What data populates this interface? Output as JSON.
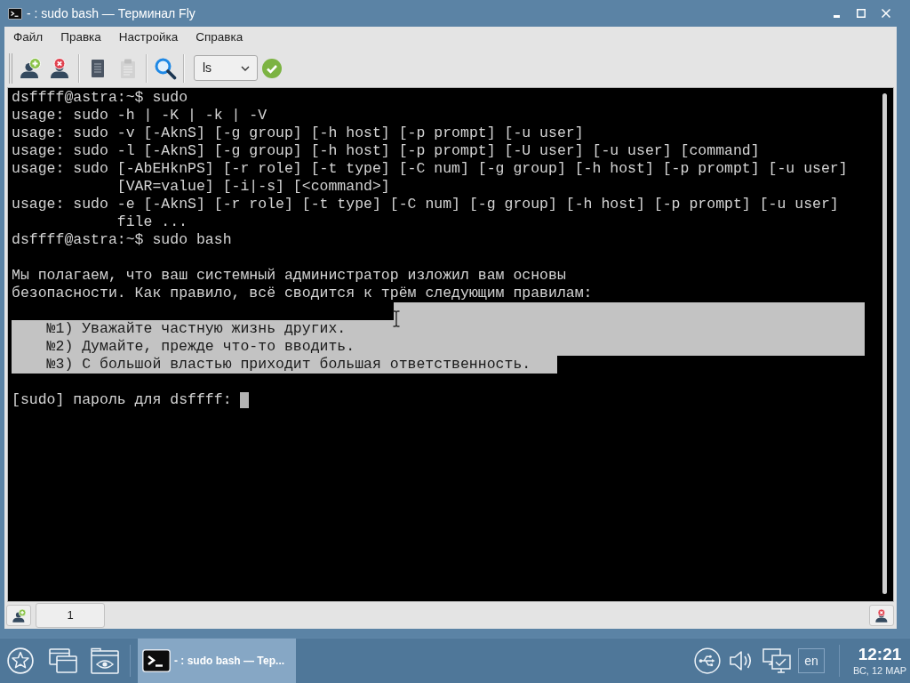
{
  "window": {
    "title": "- : sudo bash — Терминал Fly"
  },
  "menu": [
    "Файл",
    "Правка",
    "Настройка",
    "Справка"
  ],
  "toolbar": {
    "groups": [
      [
        {
          "kind": "add",
          "disabled": false
        },
        {
          "kind": "remove",
          "disabled": false
        }
      ],
      [
        {
          "kind": "copy",
          "disabled": false
        },
        {
          "kind": "paste",
          "disabled": true
        }
      ],
      [
        {
          "kind": "search",
          "disabled": false
        }
      ],
      [
        {
          "kind": "combo",
          "value": "ls"
        },
        {
          "kind": "run",
          "disabled": false
        }
      ]
    ]
  },
  "terminal": {
    "lines": [
      {
        "kind": "line",
        "text": "dsffff@astra:~$ sudo",
        "selected": false
      },
      {
        "kind": "line",
        "text": "usage: sudo -h | -K | -k | -V",
        "selected": false
      },
      {
        "kind": "line",
        "text": "usage: sudo -v [-AknS] [-g group] [-h host] [-p prompt] [-u user]",
        "selected": false
      },
      {
        "kind": "line",
        "text": "usage: sudo -l [-AknS] [-g group] [-h host] [-p prompt] [-U user] [-u user] [command]",
        "selected": false
      },
      {
        "kind": "line",
        "text": "usage: sudo [-AbEHknPS] [-r role] [-t type] [-C num] [-g group] [-h host] [-p prompt] [-u user]",
        "selected": false
      },
      {
        "kind": "continuation",
        "text": "[VAR=value] [-i|-s] [<command>]",
        "selected": false
      },
      {
        "kind": "line",
        "text": "usage: sudo -e [-AknS] [-r role] [-t type] [-C num] [-g group] [-h host] [-p prompt] [-u user]",
        "selected": false
      },
      {
        "kind": "continuation",
        "text": "file ...",
        "selected": false
      },
      {
        "kind": "line",
        "text": "dsffff@astra:~$ sudo bash",
        "selected": false
      },
      {
        "kind": "blank",
        "selected": false
      },
      {
        "kind": "line",
        "text": "Мы полагаем, что ваш системный администратор изложил вам основы",
        "selected": false
      },
      {
        "kind": "line",
        "text": "безопасности. Как правило, всё сводится к трём следующим правилам:",
        "selected": false
      },
      {
        "kind": "blank",
        "selected": true
      },
      {
        "kind": "rule",
        "text": "№1) Уважайте частную жизнь других.",
        "selected": true
      },
      {
        "kind": "rule",
        "text": "№2) Думайте, прежде что-то вводить.",
        "selected": true
      },
      {
        "kind": "rule",
        "text": "№3) С большой властью приходит большая ответственность.",
        "selected": true
      },
      {
        "kind": "blank",
        "selected": false
      },
      {
        "kind": "line",
        "text": "[sudo] пароль для dsffff:",
        "selected": false,
        "cursor": true
      }
    ]
  },
  "session_tabs": [
    {
      "label": "1",
      "selected": true
    }
  ],
  "taskbar": {
    "tasks": [
      {
        "label": "- : sudo bash — Тер...",
        "selected": true
      }
    ],
    "keyboard_layout": "en",
    "clock": {
      "time": "12:21",
      "date": "ВС, 12 МАР"
    }
  }
}
